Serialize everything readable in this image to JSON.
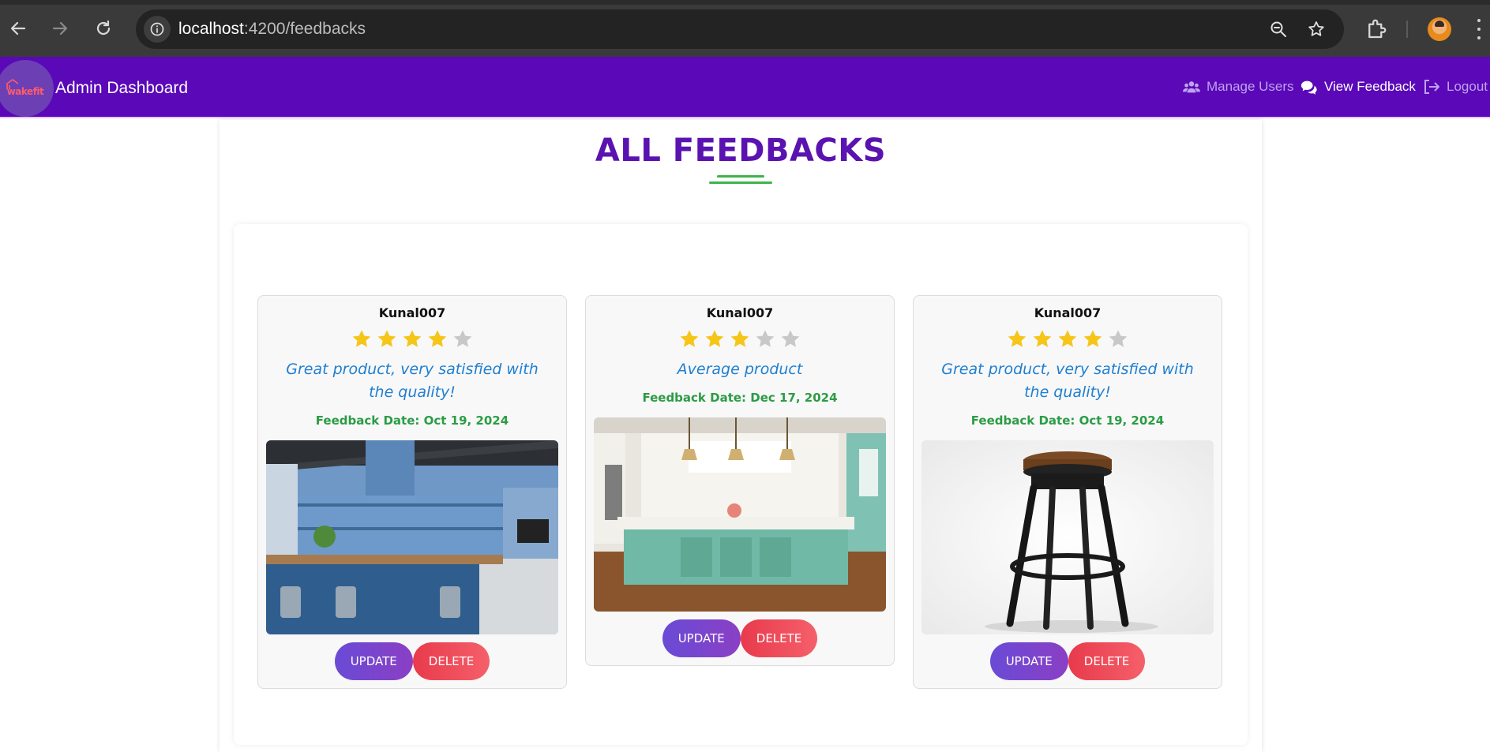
{
  "browser": {
    "url_host": "localhost",
    "url_path": ":4200/feedbacks"
  },
  "navbar": {
    "logo_text": "wakefit",
    "brand": "Admin Dashboard",
    "links": [
      {
        "label": "Manage Users",
        "icon": "users-icon"
      },
      {
        "label": "View Feedback",
        "icon": "comments-icon"
      },
      {
        "label": "Logout",
        "icon": "logout-icon"
      }
    ]
  },
  "page": {
    "title": "ALL FEEDBACKS"
  },
  "colors": {
    "navbar": "#5a08b8",
    "title": "#5a12b0",
    "comment": "#1f7fd1",
    "date": "#2b9c45",
    "star_filled": "#f5c518",
    "star_empty": "#c8c8c8"
  },
  "feedbacks": [
    {
      "user": "Kunal007",
      "rating": 4,
      "comment": "Great product, very satisfied with the quality!",
      "date": "Feedback Date: Oct 19, 2024",
      "image": "blue kitchen",
      "update_label": "UPDATE",
      "delete_label": "DELETE"
    },
    {
      "user": "Kunal007",
      "rating": 3,
      "comment": "Average product",
      "date": "Feedback Date: Dec 17, 2024",
      "image": "teal kitchen island",
      "update_label": "UPDATE",
      "delete_label": "DELETE"
    },
    {
      "user": "Kunal007",
      "rating": 4,
      "comment": "Great product, very satisfied with the quality!",
      "date": "Feedback Date: Oct 19, 2024",
      "image": "bar stool",
      "update_label": "UPDATE",
      "delete_label": "DELETE"
    }
  ]
}
